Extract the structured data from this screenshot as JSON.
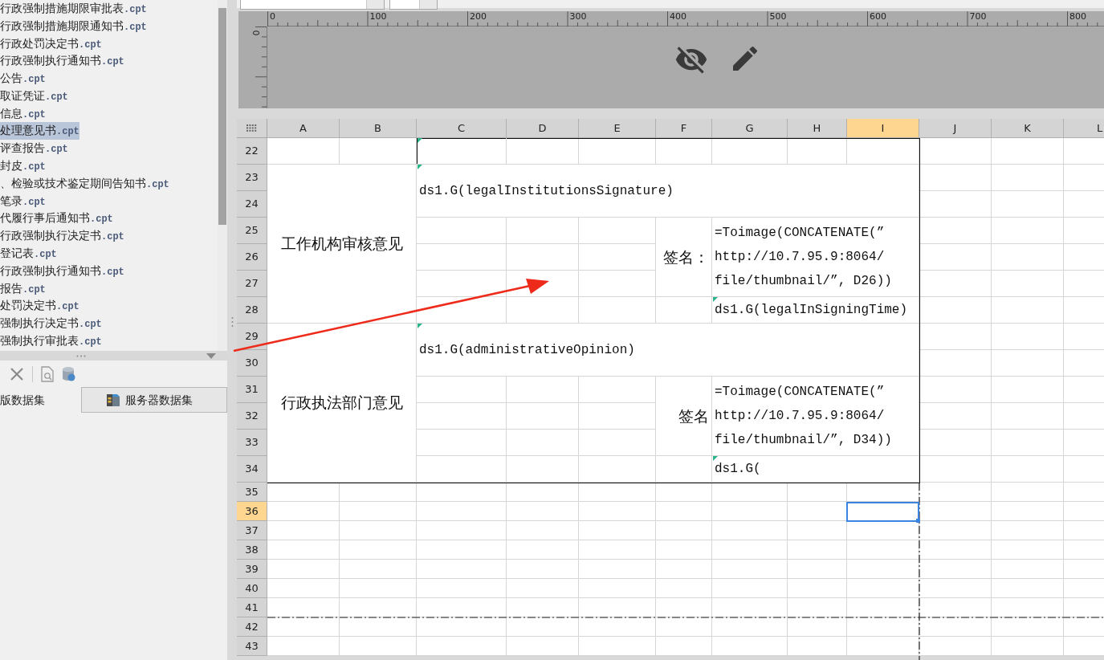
{
  "file_list": {
    "items": [
      {
        "name": "行政强制措施期限审批表",
        "ext": ".cpt",
        "selected": false
      },
      {
        "name": "行政强制措施期限通知书",
        "ext": ".cpt",
        "selected": false
      },
      {
        "name": "行政处罚决定书",
        "ext": ".cpt",
        "selected": false
      },
      {
        "name": "行政强制执行通知书",
        "ext": ".cpt",
        "selected": false
      },
      {
        "name": "公告",
        "ext": ".cpt",
        "selected": false
      },
      {
        "name": "取证凭证",
        "ext": ".cpt",
        "selected": false
      },
      {
        "name": "信息",
        "ext": ".cpt",
        "selected": false
      },
      {
        "name": "处理意见书",
        "ext": ".cpt",
        "selected": true
      },
      {
        "name": "评查报告",
        "ext": ".cpt",
        "selected": false
      },
      {
        "name": "封皮",
        "ext": ".cpt",
        "selected": false
      },
      {
        "name": "、检验或技术鉴定期间告知书",
        "ext": ".cpt",
        "selected": false
      },
      {
        "name": "笔录",
        "ext": ".cpt",
        "selected": false
      },
      {
        "name": "代履行事后通知书",
        "ext": ".cpt",
        "selected": false
      },
      {
        "name": "行政强制执行决定书",
        "ext": ".cpt",
        "selected": false
      },
      {
        "name": "登记表",
        "ext": ".cpt",
        "selected": false
      },
      {
        "name": "行政强制执行通知书",
        "ext": ".cpt",
        "selected": false
      },
      {
        "name": "报告",
        "ext": ".cpt",
        "selected": false
      },
      {
        "name": "处罚决定书",
        "ext": ".cpt",
        "selected": false
      },
      {
        "name": "强制执行决定书",
        "ext": ".cpt",
        "selected": false
      },
      {
        "name": "强制执行审批表",
        "ext": ".cpt",
        "selected": false
      }
    ]
  },
  "data_tabs": [
    {
      "label": "版数据集",
      "selected": true
    },
    {
      "label": "服务器数据集",
      "selected": false
    }
  ],
  "ruler": {
    "labels": [
      "0",
      "100",
      "200",
      "300",
      "400",
      "500",
      "600",
      "700",
      "800"
    ],
    "vertical_label": "0"
  },
  "sheet": {
    "columns": [
      {
        "label": "A",
        "selected": false
      },
      {
        "label": "B",
        "selected": false
      },
      {
        "label": "C",
        "selected": false
      },
      {
        "label": "D",
        "selected": false
      },
      {
        "label": "E",
        "selected": false
      },
      {
        "label": "F",
        "selected": false
      },
      {
        "label": "G",
        "selected": false
      },
      {
        "label": "H",
        "selected": false
      },
      {
        "label": "I",
        "selected": true
      },
      {
        "label": "J",
        "selected": false
      },
      {
        "label": "K",
        "selected": false
      },
      {
        "label": "L",
        "selected": false
      }
    ],
    "rows": [
      {
        "label": "22",
        "selected": false
      },
      {
        "label": "23",
        "selected": false
      },
      {
        "label": "24",
        "selected": false
      },
      {
        "label": "25",
        "selected": false
      },
      {
        "label": "26",
        "selected": false
      },
      {
        "label": "27",
        "selected": false
      },
      {
        "label": "28",
        "selected": false
      },
      {
        "label": "29",
        "selected": false
      },
      {
        "label": "30",
        "selected": false
      },
      {
        "label": "31",
        "selected": false
      },
      {
        "label": "32",
        "selected": false
      },
      {
        "label": "33",
        "selected": false
      },
      {
        "label": "34",
        "selected": false
      },
      {
        "label": "35",
        "selected": false
      },
      {
        "label": "36",
        "selected": true
      },
      {
        "label": "37",
        "selected": false
      },
      {
        "label": "38",
        "selected": false
      },
      {
        "label": "39",
        "selected": false
      },
      {
        "label": "40",
        "selected": false
      },
      {
        "label": "41",
        "selected": false
      },
      {
        "label": "42",
        "selected": false
      },
      {
        "label": "43",
        "selected": false
      }
    ],
    "cells": [
      {
        "kind": "empty",
        "marker": true
      },
      {
        "kind": "heading",
        "lines": [
          "工作机构审核意见"
        ],
        "marker": false
      },
      {
        "kind": "formula",
        "lines": [
          "ds1.G(legalInstitutionsSignature)"
        ],
        "marker": true
      },
      {
        "kind": "caption",
        "lines": [
          "签名："
        ],
        "marker": false
      },
      {
        "kind": "formula",
        "lines": [
          "=Toimage(CONCATENATE(”",
          "http://10.7.95.9:8064/",
          "file/thumbnail/”, D26))"
        ],
        "marker": false
      },
      {
        "kind": "formula",
        "lines": [
          "ds1.G(legalInSigningTime)"
        ],
        "marker": true
      },
      {
        "kind": "heading",
        "lines": [
          "行政执法部门意见"
        ],
        "marker": false
      },
      {
        "kind": "formula",
        "lines": [
          "ds1.G(administrativeOpinion)"
        ],
        "marker": true
      },
      {
        "kind": "caption",
        "lines": [
          "签名"
        ],
        "marker": false
      },
      {
        "kind": "formula",
        "lines": [
          "=Toimage(CONCATENATE(”",
          "http://10.7.95.9:8064/",
          "file/thumbnail/”, D34))"
        ],
        "marker": false
      },
      {
        "kind": "formula",
        "lines": [
          "ds1.G("
        ],
        "marker": true
      }
    ]
  }
}
